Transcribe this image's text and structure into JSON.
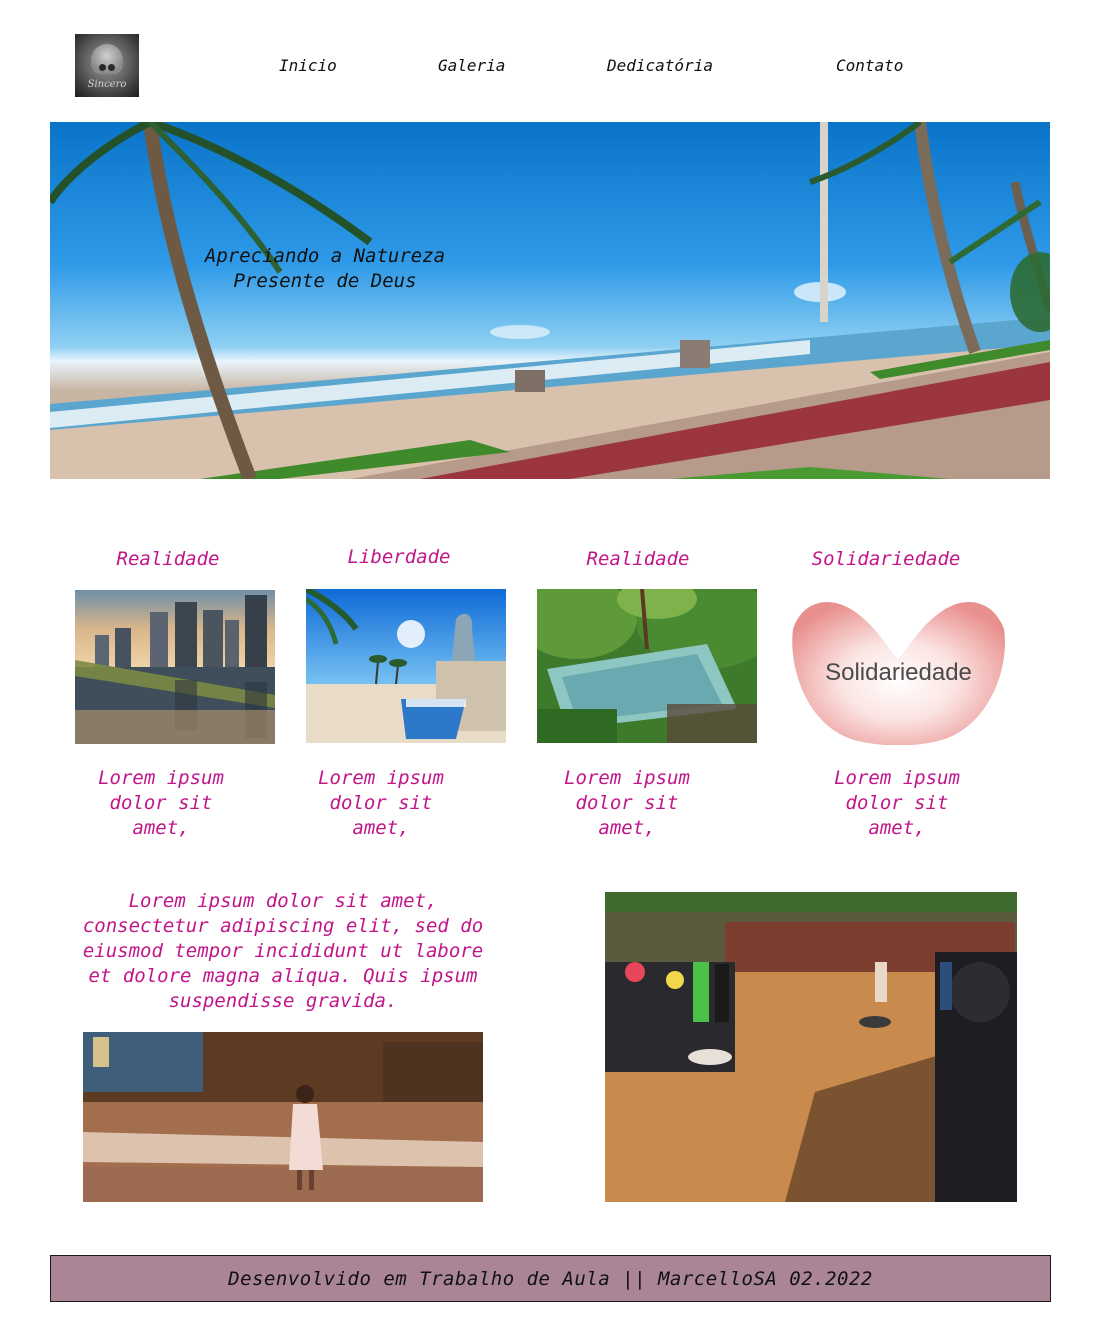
{
  "header": {
    "logo_text": "Sincero",
    "nav": [
      {
        "label": "Inicio"
      },
      {
        "label": "Galeria"
      },
      {
        "label": "Dedicatória"
      },
      {
        "label": "Contato"
      }
    ]
  },
  "hero": {
    "title_line1": "Apreciando a Natureza",
    "title_line2": "Presente de Deus"
  },
  "cards": [
    {
      "title": "Realidade",
      "desc": "Lorem ipsum dolor sit amet,"
    },
    {
      "title": "Liberdade",
      "desc": "Lorem ipsum dolor sit amet,"
    },
    {
      "title": "Realidade",
      "desc": "Lorem ipsum dolor sit amet,"
    },
    {
      "title": "Solidariedade",
      "desc": "Lorem ipsum dolor sit amet,",
      "image_text": "Solidariedade"
    }
  ],
  "section": {
    "paragraph": "Lorem ipsum dolor sit amet, consectetur adipiscing elit, sed do eiusmod tempor incididunt ut labore et dolore magna aliqua. Quis ipsum suspendisse gravida."
  },
  "footer": {
    "text": "Desenvolvido em Trabalho de Aula || MarcelloSA 02.2022"
  },
  "colors": {
    "accent": "#c0168a",
    "footer_bg": "#a98595"
  }
}
